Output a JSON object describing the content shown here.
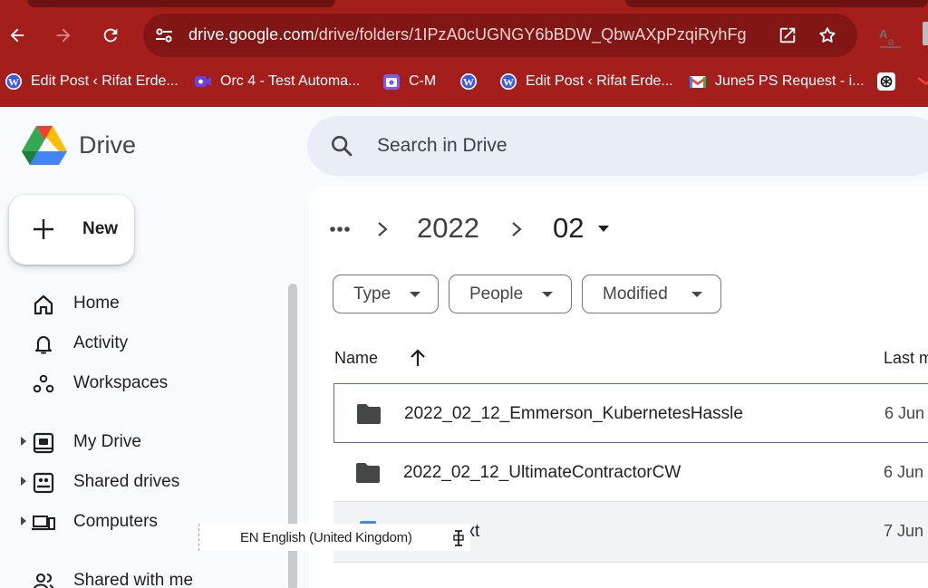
{
  "browser": {
    "url_host": "drive.google.com",
    "url_path": "/drive/folders/1IPzA0cUGNGY6bBDW_QbwAXpPzqiRyhFg",
    "bookmarks": [
      {
        "label": "Edit Post ‹ Rifat Erde...",
        "icon": "wordpress-icon"
      },
      {
        "label": "Orc 4 - Test Automa...",
        "icon": "video-icon"
      },
      {
        "label": "C-M",
        "icon": "calendar-icon"
      },
      {
        "label": "",
        "icon": "wordpress-icon"
      },
      {
        "label": "Edit Post ‹ Rifat Erde...",
        "icon": "wordpress-icon"
      },
      {
        "label": "June5 PS Request - i...",
        "icon": "gmail-icon"
      },
      {
        "label": "",
        "icon": "openai-icon"
      }
    ]
  },
  "drive": {
    "brand": "Drive",
    "search_placeholder": "Search in Drive",
    "new_label": "New",
    "nav": [
      {
        "label": "Home",
        "icon": "home-icon",
        "expandable": false
      },
      {
        "label": "Activity",
        "icon": "bell-icon",
        "expandable": false
      },
      {
        "label": "Workspaces",
        "icon": "workspaces-icon",
        "expandable": false
      },
      {
        "label": "My Drive",
        "icon": "my-drive-icon",
        "expandable": true
      },
      {
        "label": "Shared drives",
        "icon": "shared-drives-icon",
        "expandable": true
      },
      {
        "label": "Computers",
        "icon": "computers-icon",
        "expandable": true
      },
      {
        "label": "Shared with me",
        "icon": "shared-with-me-icon",
        "expandable": false
      }
    ],
    "breadcrumb": {
      "items": [
        "2022",
        "02"
      ]
    },
    "filters": [
      "Type",
      "People",
      "Modified"
    ],
    "columns": {
      "name": "Name",
      "last_modified": "Last m"
    },
    "files": [
      {
        "name": "2022_02_12_Emmerson_KubernetesHassle",
        "date": "6 Jun",
        "type": "folder"
      },
      {
        "name": "2022_02_12_UltimateContractorCW",
        "date": "6 Jun",
        "type": "folder"
      },
      {
        "name": ".txt",
        "date": "7 Jun",
        "type": "doc"
      }
    ]
  },
  "ime_tooltip": {
    "text": "EN English (United Kingdom)"
  },
  "colors": {
    "chrome_bg": "#a41e1c",
    "omnibox_bg": "#811614",
    "drive_bg": "#f8fafd",
    "search_bg": "#e9eef6",
    "selection_border": "#5b6abf"
  }
}
